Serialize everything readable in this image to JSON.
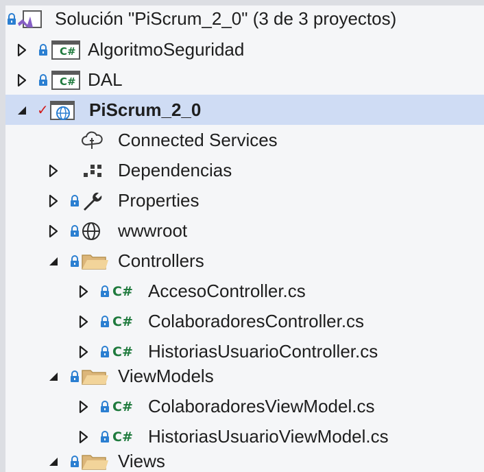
{
  "tree": {
    "solution": {
      "label": "Solución \"PiScrum_2_0\" (3 de 3 proyectos)",
      "icon": "solution-icon"
    },
    "projects": [
      {
        "label": "AlgoritmoSeguridad",
        "icon": "csharp-project-icon",
        "expanded": false
      },
      {
        "label": "DAL",
        "icon": "csharp-project-icon",
        "expanded": false
      },
      {
        "label": "PiScrum_2_0",
        "icon": "web-project-icon",
        "expanded": true,
        "selected": true
      }
    ],
    "items": {
      "connected_services": "Connected Services",
      "dependencias": "Dependencias",
      "properties": "Properties",
      "wwwroot": "wwwroot",
      "controllers": "Controllers",
      "viewmodels": "ViewModels",
      "views": "Views"
    },
    "controllers_files": [
      "AccesoController.cs",
      "ColaboradoresController.cs",
      "HistoriasUsuarioController.cs"
    ],
    "viewmodels_files": [
      "ColaboradoresViewModel.cs",
      "HistoriasUsuarioViewModel.cs"
    ],
    "cs_badge": "C#",
    "colors": {
      "background": "#f5f6f8",
      "selected_row": "#cfdcf4",
      "text": "#1e1e1e",
      "lock": "#2b7fd1",
      "csharp_green": "#1f7a3d",
      "folder": "#dcb67a",
      "check_red": "#d11b1b"
    }
  }
}
